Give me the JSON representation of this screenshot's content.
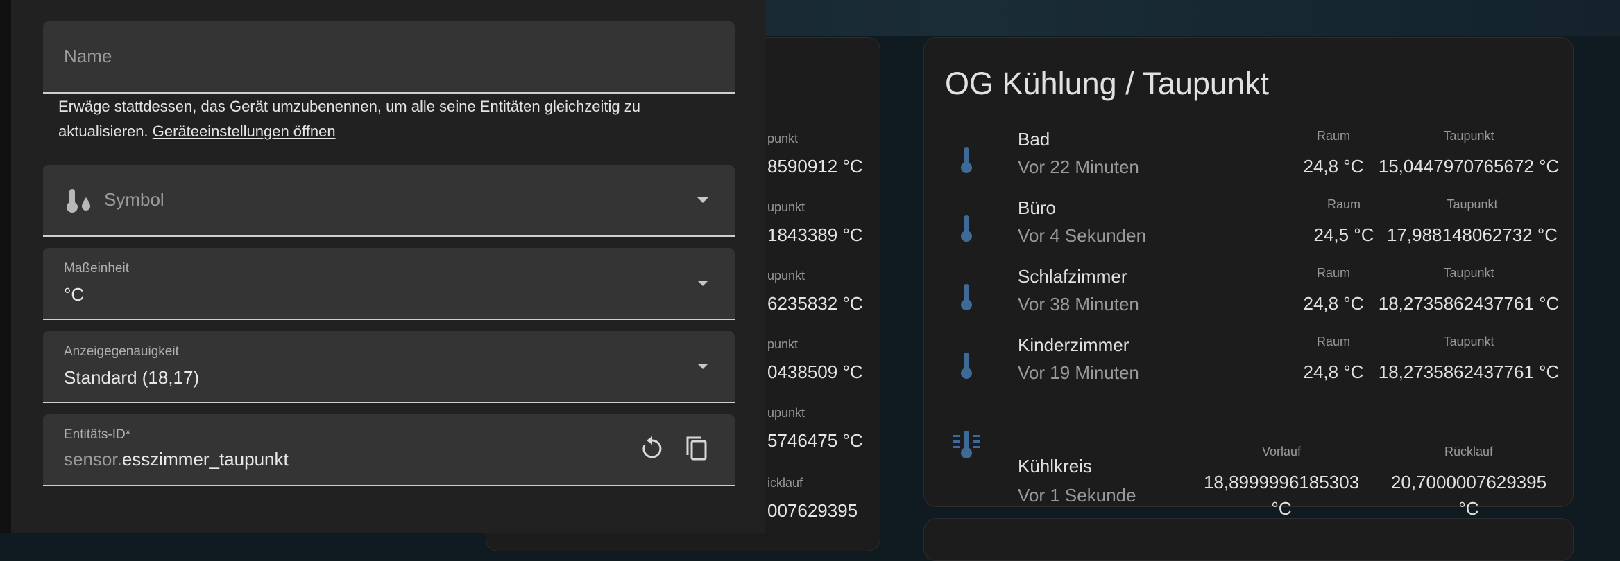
{
  "dialog": {
    "name_placeholder": "Name",
    "helper_text": "Erwäge stattdessen, das Gerät umzubenennen, um alle seine Entitäten gleichzeitig zu aktualisieren.",
    "helper_link": "Geräteeinstellungen öffnen",
    "symbol_placeholder": "Symbol",
    "unit_label": "Maßeinheit",
    "unit_value": "°C",
    "precision_label": "Anzeigegenauigkeit",
    "precision_value": "Standard (18,17)",
    "entity_label": "Entitäts-ID*",
    "entity_prefix": "sensor.",
    "entity_value": "esszimmer_taupunkt"
  },
  "background_card": {
    "cells": [
      {
        "label": "punkt",
        "value": "8590912 °C"
      },
      {
        "label": "upunkt",
        "value": "1843389 °C"
      },
      {
        "label": "upunkt",
        "value": "6235832 °C"
      },
      {
        "label": "punkt",
        "value": "0438509 °C"
      },
      {
        "label": "upunkt",
        "value": "5746475 °C"
      },
      {
        "label": "icklauf",
        "value": "007629395"
      }
    ]
  },
  "card": {
    "title": "OG Kühlung / Taupunkt",
    "rows": [
      {
        "name": "Bad",
        "time": "Vor 22 Minuten",
        "label1": "Raum",
        "value1": "24,8 °C",
        "label2": "Taupunkt",
        "value2": "15,0447970765672 °C"
      },
      {
        "name": "Büro",
        "time": "Vor 4 Sekunden",
        "label1": "Raum",
        "value1": "24,5 °C",
        "label2": "Taupunkt",
        "value2": "17,988148062732 °C"
      },
      {
        "name": "Schlafzimmer",
        "time": "Vor 38 Minuten",
        "label1": "Raum",
        "value1": "24,8 °C",
        "label2": "Taupunkt",
        "value2": "18,2735862437761 °C"
      },
      {
        "name": "Kinderzimmer",
        "time": "Vor 19 Minuten",
        "label1": "Raum",
        "value1": "24,8 °C",
        "label2": "Taupunkt",
        "value2": "18,2735862437761 °C"
      },
      {
        "name": "Kühlkreis",
        "time": "Vor 1 Sekunde",
        "label1": "Vorlauf",
        "value1a": "18,8999996185303",
        "value1b": "°C",
        "label2": "Rücklauf",
        "value2a": "20,7000007629395",
        "value2b": "°C"
      }
    ]
  },
  "icons": {
    "thermometer": "thermometer-icon",
    "cooling": "thermometer-lines-icon",
    "symbol": "thermometer-water-icon",
    "regenerate": "restore-icon",
    "copy": "copy-icon"
  },
  "colors": {
    "icon_blue": "#3d6a96",
    "dialog_bg": "#212121",
    "field_bg": "#343434",
    "card_bg": "#1c1c1c"
  }
}
